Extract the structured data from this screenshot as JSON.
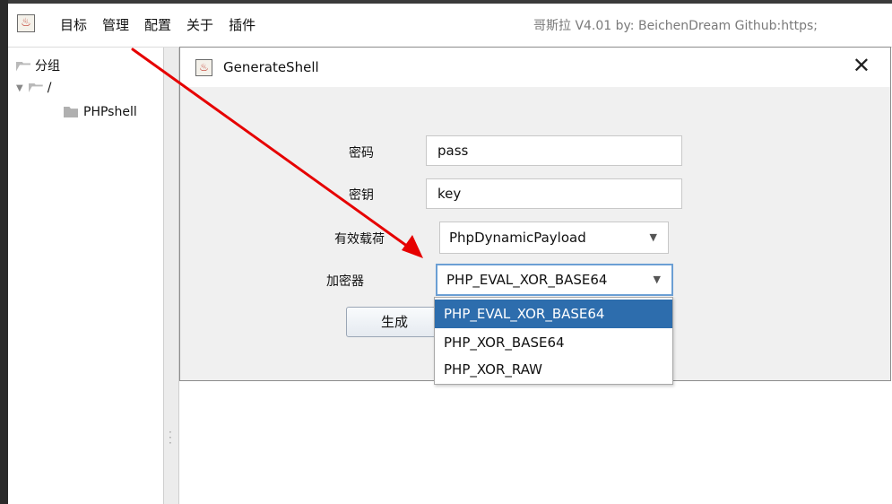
{
  "menubar": {
    "items": [
      "目标",
      "管理",
      "配置",
      "关于",
      "插件"
    ],
    "app_info": "哥斯拉  V4.01 by: BeichenDream Github:https;"
  },
  "tree": {
    "root_label": "分组",
    "child_label": "/",
    "leaf_label": "PHPshell"
  },
  "dialog": {
    "title": "GenerateShell",
    "close_glyph": "✕",
    "fields": {
      "password_label": "密码",
      "password_value": "pass",
      "key_label": "密钥",
      "key_value": "key",
      "payload_label": "有效载荷",
      "payload_value": "PhpDynamicPayload",
      "cryption_label": "加密器",
      "cryption_value": "PHP_EVAL_XOR_BASE64"
    },
    "generate_label": "生成"
  },
  "cryption_options": [
    "PHP_EVAL_XOR_BASE64",
    "PHP_XOR_BASE64",
    "PHP_XOR_RAW"
  ],
  "selected_option_index": 0,
  "colors": {
    "selection": "#2d6dad",
    "annotation_arrow": "#e60000",
    "focus_border": "#6b9fd4"
  },
  "icons": [
    "app-icon",
    "folder-open-icon",
    "folder-closed-icon",
    "expand-triangle-icon",
    "close-icon",
    "dropdown-arrow-icon",
    "grip-icon",
    "annotation-arrow"
  ]
}
